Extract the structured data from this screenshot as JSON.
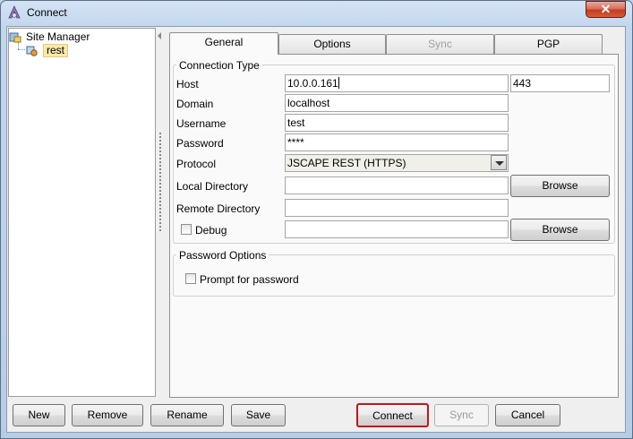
{
  "window": {
    "title": "Connect",
    "close_glyph": "✕"
  },
  "tree": {
    "root_label": "Site Manager",
    "child_label": "rest",
    "root_icon": "server-tree-icon",
    "child_icon": "connection-icon"
  },
  "tabs": [
    {
      "label": "General",
      "active": true
    },
    {
      "label": "Options"
    },
    {
      "label": "Sync",
      "disabled": true
    },
    {
      "label": "PGP"
    }
  ],
  "connection_type": {
    "legend": "Connection Type",
    "host_label": "Host",
    "host_value": "10.0.0.161",
    "port_value": "443",
    "domain_label": "Domain",
    "domain_value": "localhost",
    "username_label": "Username",
    "username_value": "test",
    "password_label": "Password",
    "password_value": "****",
    "protocol_label": "Protocol",
    "protocol_value": "JSCAPE REST (HTTPS)",
    "local_dir_label": "Local Directory",
    "local_dir_value": "",
    "remote_dir_label": "Remote Directory",
    "remote_dir_value": "",
    "debug_label": "Debug",
    "debug_value": "",
    "browse_label": "Browse"
  },
  "password_options": {
    "legend": "Password Options",
    "prompt_label": "Prompt for password"
  },
  "buttons": {
    "new": "New",
    "remove": "Remove",
    "rename": "Rename",
    "save": "Save",
    "connect": "Connect",
    "sync": "Sync",
    "cancel": "Cancel"
  },
  "colors": {
    "connect_border": "#c0151b",
    "selection_bg": "#fce9a8"
  }
}
